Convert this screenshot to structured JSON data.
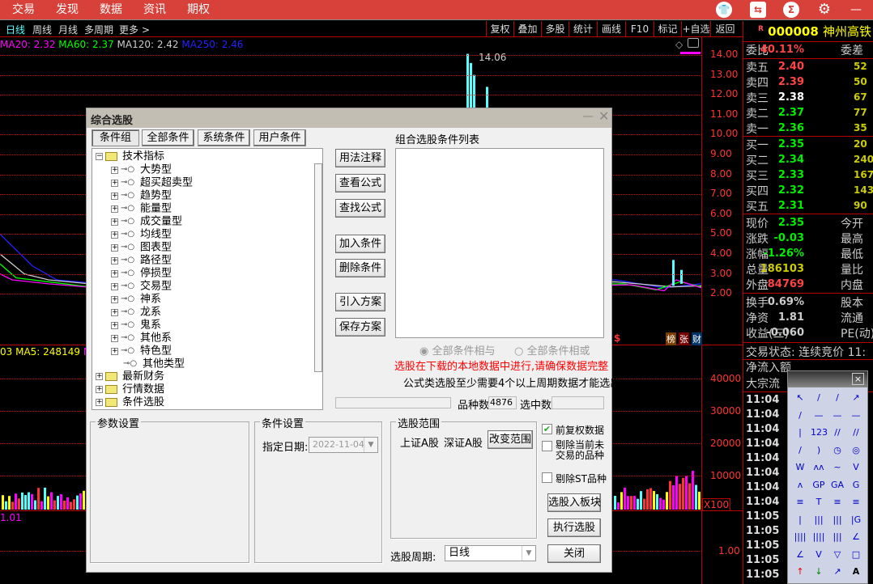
{
  "menu": [
    "交易",
    "发现",
    "数据",
    "资讯",
    "期权"
  ],
  "top_icons": [
    "shirt-icon",
    "settings-slider-icon",
    "sigma-icon",
    "gear-icon"
  ],
  "period_tabs": [
    "日线",
    "周线",
    "月线",
    "多周期",
    "更多 >"
  ],
  "toolbar_buttons": [
    "复权",
    "叠加",
    "多股",
    "统计",
    "画线",
    "F10",
    "标记",
    "+自选",
    "返回"
  ],
  "ma": {
    "ma20": "MA20: 2.32",
    "ma60": "MA60: 2.37",
    "ma120": "MA120: 2.42",
    "ma250": "MA250: 2.46"
  },
  "colors": {
    "accent": "#d8403a",
    "up": "#ff3333",
    "down": "#00ee00",
    "ma20": "#ff00ff",
    "ma60": "#00ff00",
    "ma120": "#cccccc",
    "ma250": "#0000ff"
  },
  "price_axis": [
    "14.00",
    "13.00",
    "12.00",
    "11.00",
    "10.00",
    "9.00",
    "8.00",
    "7.00",
    "6.00",
    "5.00",
    "4.00",
    "3.00",
    "2.00"
  ],
  "peak_label": "14.06",
  "badges": [
    "榜",
    "张",
    "财"
  ],
  "dollar_mark": "$",
  "volume": {
    "header_left": "03",
    "ma5": "MA5: 248149",
    "header_right": "M",
    "axis": [
      "40000",
      "30000",
      "20000",
      "10000"
    ],
    "unit": "X100"
  },
  "lower": {
    "value": "1.01",
    "axis": [
      "1.00"
    ]
  },
  "stock": {
    "badge": "R",
    "code": "000008",
    "name": "神州高铁"
  },
  "quote": {
    "weibi_label": "委比",
    "weibi": "40.11%",
    "weicha_label": "委差",
    "sell": [
      {
        "l": "卖五",
        "p": "2.40",
        "q": "52"
      },
      {
        "l": "卖四",
        "p": "2.39",
        "q": "50"
      },
      {
        "l": "卖三",
        "p": "2.38",
        "q": "67"
      },
      {
        "l": "卖二",
        "p": "2.37",
        "q": "77"
      },
      {
        "l": "卖一",
        "p": "2.36",
        "q": "35"
      }
    ],
    "buy": [
      {
        "l": "买一",
        "p": "2.35",
        "q": "20"
      },
      {
        "l": "买二",
        "p": "2.34",
        "q": "240"
      },
      {
        "l": "买三",
        "p": "2.33",
        "q": "167"
      },
      {
        "l": "买四",
        "p": "2.32",
        "q": "143"
      },
      {
        "l": "买五",
        "p": "2.31",
        "q": "90"
      }
    ],
    "stats": [
      {
        "l": "现价",
        "v": "2.35",
        "r": "今开"
      },
      {
        "l": "涨跌",
        "v": "-0.03",
        "r": "最高"
      },
      {
        "l": "涨幅",
        "v": "-1.26%",
        "r": "最低"
      },
      {
        "l": "总量",
        "v": "186103",
        "r": "量比"
      },
      {
        "l": "外盘",
        "v": "84769",
        "r": "内盘"
      }
    ],
    "fund": [
      {
        "l": "换手",
        "v": "0.69%",
        "r": "股本"
      },
      {
        "l": "净资",
        "v": "1.81",
        "r": "流通"
      },
      {
        "l": "收益(三)",
        "v": "-0.060",
        "r": "PE(动)"
      }
    ],
    "status": "交易状态: 连续竞价 11:",
    "netflow": "净流入额",
    "block": "大宗流",
    "times": [
      "11:04",
      "11:04",
      "11:04",
      "11:04",
      "11:04",
      "11:04",
      "11:04",
      "11:04",
      "11:05",
      "11:05",
      "11:05",
      "11:05",
      "11:05"
    ]
  },
  "dialog": {
    "title": "综合选股",
    "tabs": [
      "条件组",
      "全部条件",
      "系统条件",
      "用户条件"
    ],
    "tree": {
      "root": "技术指标",
      "children": [
        "大势型",
        "超买超卖型",
        "趋势型",
        "能量型",
        "成交量型",
        "均线型",
        "图表型",
        "路径型",
        "停损型",
        "交易型",
        "神系",
        "龙系",
        "鬼系",
        "其他系",
        "特色型",
        "其他类型"
      ],
      "others": [
        "最新财务",
        "行情数据",
        "条件选股"
      ]
    },
    "side_buttons": [
      "用法注释",
      "查看公式",
      "查找公式",
      "加入条件",
      "删除条件",
      "引入方案",
      "保存方案"
    ],
    "list_title": "组合选股条件列表",
    "radio_and": "全部条件相与",
    "radio_or": "全部条件相或",
    "warning": "选股在下载的本地数据中进行,请确保数据完整",
    "note": "公式类选股至少需要4个以上周期数据才能选出",
    "count_label": "品种数",
    "count": "4876",
    "selected_label": "选中数",
    "param_group": "参数设置",
    "cond_group": "条件设置",
    "date_label": "指定日期:",
    "date": "2022-11-04",
    "range_group": "选股范围",
    "range_sh": "上证A股",
    "range_sz": "深证A股",
    "change_range": "改变范围",
    "chk_fq": "前复权数据",
    "chk_untraded": "剔除当前未交易的品种",
    "chk_st": "剔除ST品种",
    "btn_block": "选股入板块",
    "btn_run": "执行选股",
    "btn_close": "关闭",
    "period_label": "选股周期:",
    "period": "日线"
  },
  "draw_tools": {
    "close": "×",
    "labels": [
      "↖",
      "/",
      "/",
      "↗",
      "/",
      "—",
      "—",
      "—",
      "|",
      "123",
      "//",
      "//",
      "/",
      ")",
      "◷",
      "◎",
      "W",
      "ʌʌ",
      "~",
      "V",
      "ʌ",
      "GP",
      "GA",
      "G",
      "≡",
      "T",
      "≡",
      "≡",
      "|",
      "|||",
      "|||",
      "|G",
      "||||",
      "||||",
      "|||",
      "∠",
      "∠",
      "V",
      "▽",
      "□",
      "↑",
      "↓",
      "↗",
      "A"
    ]
  }
}
